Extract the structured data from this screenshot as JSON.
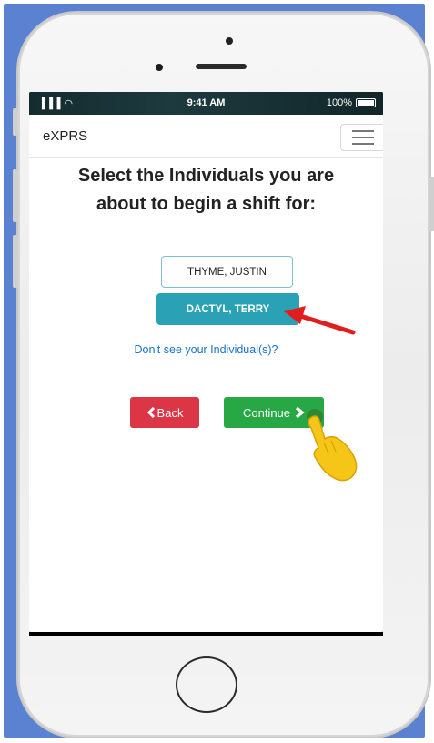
{
  "status_bar": {
    "signal": "▐▐▐ ◠",
    "time": "9:41 AM",
    "battery": "100%"
  },
  "app": {
    "brand": "eXPRS",
    "heading_line1": "Select the Individuals you are",
    "heading_line2": "about to begin a shift for:",
    "individuals": [
      {
        "label": "THYME, JUSTIN",
        "selected": false
      },
      {
        "label": "DACTYL, TERRY",
        "selected": true
      }
    ],
    "missing_link": "Don't see your Individual(s)?",
    "back_label": "Back",
    "continue_label": "Continue"
  },
  "colors": {
    "background_frame": "#5b82d0",
    "selected": "#2aa1b5",
    "back": "#dc3545",
    "continue": "#28a745",
    "link": "#1a73c9",
    "annotation_arrow": "#e21d1d",
    "pointer_hand": "#f5c518"
  },
  "icons": {
    "back": "chevron-left-icon",
    "continue": "chevron-right-icon",
    "menu": "hamburger-menu-icon",
    "annotation": "red-arrow-icon",
    "pointer": "pointing-hand-icon"
  }
}
